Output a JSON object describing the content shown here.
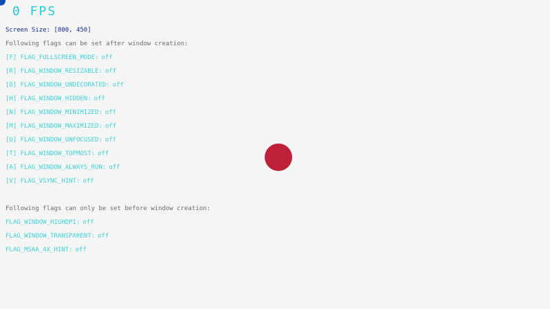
{
  "fps_text": "0 FPS",
  "screen_size_text": "Screen Size: [800, 450]",
  "section_after": {
    "heading": "Following flags can be set after window creation:",
    "flags": [
      {
        "label": "[F] FLAG_FULLSCREEN_MODE:",
        "state": "off"
      },
      {
        "label": "[R] FLAG_WINDOW_RESIZABLE:",
        "state": "off"
      },
      {
        "label": "[D] FLAG_WINDOW_UNDECORATED:",
        "state": "off"
      },
      {
        "label": "[H] FLAG_WINDOW_HIDDEN:",
        "state": "off"
      },
      {
        "label": "[N] FLAG_WINDOW_MINIMIZED:",
        "state": "off"
      },
      {
        "label": "[M] FLAG_WINDOW_MAXIMIZED:",
        "state": "off"
      },
      {
        "label": "[U] FLAG_WINDOW_UNFOCUSED:",
        "state": "off"
      },
      {
        "label": "[T] FLAG_WINDOW_TOPMOST:",
        "state": "off"
      },
      {
        "label": "[A] FLAG_WINDOW_ALWAYS_RUN:",
        "state": "off"
      },
      {
        "label": "[V] FLAG_VSYNC_HINT:",
        "state": "off"
      }
    ]
  },
  "section_before": {
    "heading": "Following flags can only be set before window creation:",
    "flags": [
      {
        "label": "FLAG_WINDOW_HIGHDPI:",
        "state": "off"
      },
      {
        "label": "FLAG_WINDOW_TRANSPARENT:",
        "state": "off"
      },
      {
        "label": "FLAG_MSAA_4X_HINT:",
        "state": "off"
      }
    ]
  },
  "colors": {
    "background": "#f5f5f5",
    "fps": "#28c8d8",
    "screen_size": "#0e2a86",
    "flag_text": "#3ed1d8",
    "heading_text": "#6b6b6b",
    "ball": "#be2039",
    "corner_dot": "#0b4fb0"
  }
}
